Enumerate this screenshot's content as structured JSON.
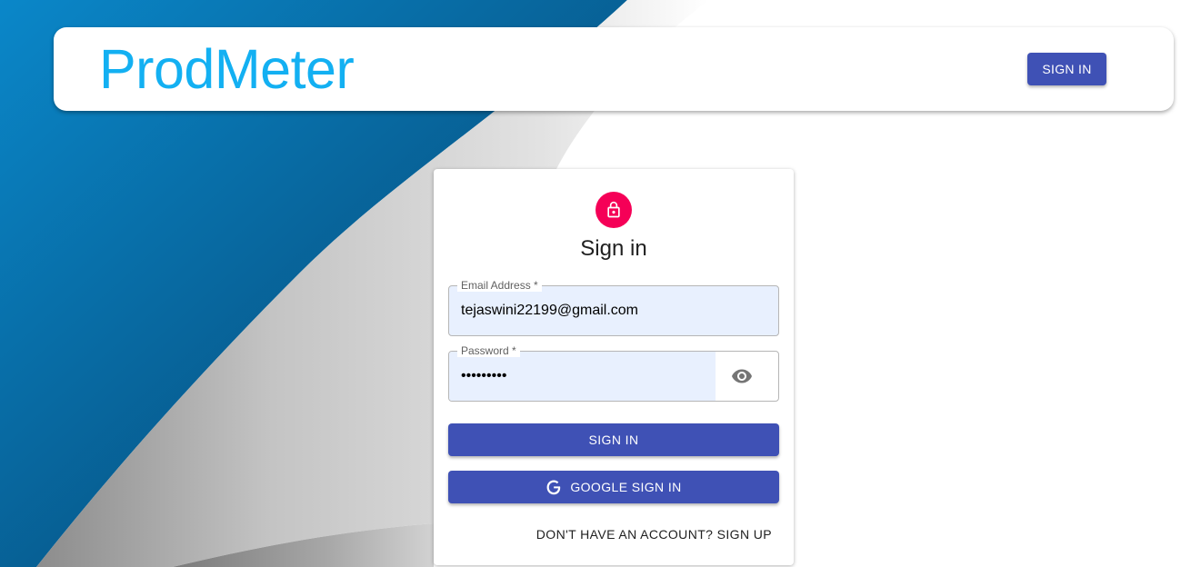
{
  "header": {
    "brand": "ProdMeter",
    "signin_label": "SIGN IN"
  },
  "login": {
    "title": "Sign in",
    "email": {
      "label": "Email Address *",
      "value": "tejaswini22199@gmail.com"
    },
    "password": {
      "label": "Password *",
      "value": "•••••••••"
    },
    "signin_button": "SIGN IN",
    "google_button": "GOOGLE SIGN IN",
    "signup_link": "DON'T HAVE AN ACCOUNT? SIGN UP"
  },
  "colors": {
    "brand": "#13b0f2",
    "primary": "#3f51b5",
    "avatar": "#f50057",
    "autofill": "#e8f0fe",
    "background_blue": "#0a6fa8"
  },
  "icons": {
    "avatar": "lock-icon",
    "password_toggle": "eye-icon",
    "google": "google-g-icon"
  }
}
